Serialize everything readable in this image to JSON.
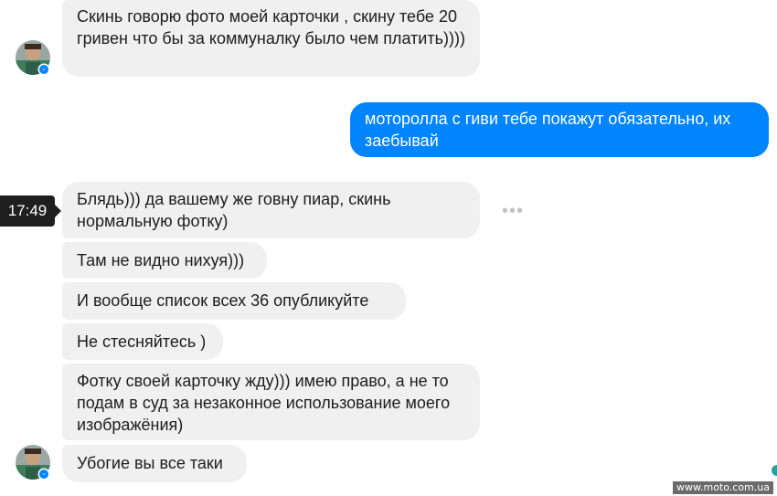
{
  "conversation": {
    "messages": [
      {
        "sender": "contact",
        "text": "Скинь говорю фото моей карточки , скину тебе 20 гривен что бы за коммуналку было чем платить))))"
      },
      {
        "sender": "me",
        "text": "моторолла с гиви тебе покажут обязательно, их заебывай"
      },
      {
        "sender": "contact",
        "text": "Блядь))) да вашему же говну пиар, скинь нормальную фотку)"
      },
      {
        "sender": "contact",
        "text": "Там не видно нихуя)))"
      },
      {
        "sender": "contact",
        "text": "И вообще список всех 36 опубликуйте"
      },
      {
        "sender": "contact",
        "text": "Не стесняйтесь )"
      },
      {
        "sender": "contact",
        "text": "Фотку своей карточку жду))) имею право, а не то подам в суд за незаконное использование моего изображёния)"
      },
      {
        "sender": "contact",
        "text": "Убогие вы все таки"
      }
    ],
    "timestamp": "17:49",
    "more_icon": "more-options-icon",
    "messenger_badge_icon": "messenger-badge-icon"
  },
  "colors": {
    "incoming_bubble": "#f1f0f0",
    "outgoing_bubble": "#0084ff",
    "timestamp_bg": "#1f1f1f",
    "messenger_badge": "#0084ff"
  },
  "watermark": "www.moto.com.ua"
}
